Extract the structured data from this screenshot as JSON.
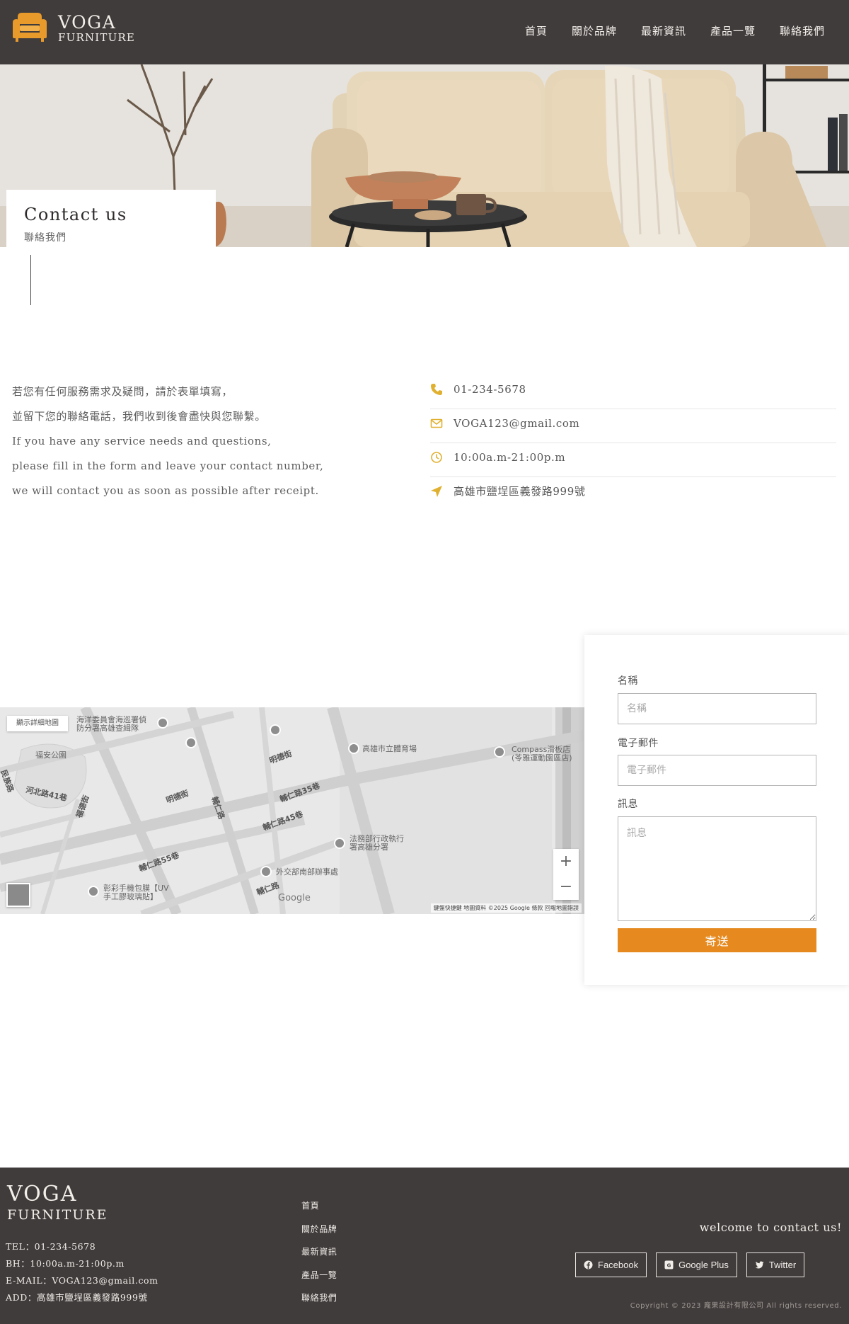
{
  "header": {
    "logo_line1": "VOGA",
    "logo_line2": "FURNITURE",
    "nav": [
      "首頁",
      "關於品牌",
      "最新資訊",
      "產品一覽",
      "聯絡我們"
    ]
  },
  "hero": {
    "title": "Contact us",
    "subtitle": "聯絡我們"
  },
  "intro": {
    "lines": [
      "若您有任何服務需求及疑問，請於表單填寫，",
      "並留下您的聯絡電話，我們收到後會盡快與您聯繫。",
      "If you have any service needs and questions,",
      "please fill in the form and leave your contact number,",
      "we will contact you as soon as possible after receipt."
    ]
  },
  "info": {
    "phone": "01-234-5678",
    "email": "VOGA123@gmail.com",
    "hours": "10:00a.m-21:00p.m",
    "address": "高雄市鹽埕區義發路999號"
  },
  "map": {
    "detail_button": "顯示詳細地圖",
    "labels": {
      "poi1": "海洋委員會海巡署偵\n防分署高雄查緝隊",
      "poi2": "福安公園",
      "poi3": "高雄市立體育場",
      "poi4": "Compass滑板店\n(苓雅運動園區店)",
      "poi5": "法務部行政執行\n署高雄分署",
      "poi6": "外交部南部辦事處",
      "poi7": "彰彩手機包膜【UV\n手工膠玻璃貼】"
    },
    "streets": [
      "明德街",
      "明德街",
      "輔仁路35巷",
      "輔仁路45巷",
      "輔仁路55巷",
      "輔仁路",
      "河北路41巷",
      "福德街",
      "輔仁路",
      "民族路"
    ],
    "brand": "Google",
    "footer": "鍵盤快捷鍵   地圖資料 ©2025 Google   條款   回報地圖錯誤",
    "zoom_in": "+",
    "zoom_out": "−"
  },
  "form": {
    "name_label": "名稱",
    "name_placeholder": "名稱",
    "email_label": "電子郵件",
    "email_placeholder": "電子郵件",
    "message_label": "訊息",
    "message_placeholder": "訊息",
    "submit": "寄送"
  },
  "footer": {
    "logo_line1": "VOGA",
    "logo_line2": "FURNITURE",
    "tel": "TEL：01-234-5678",
    "bh": "BH：10:00a.m-21:00p.m",
    "email": "E-MAIL：VOGA123@gmail.com",
    "add": "ADD：高雄市鹽埕區義發路999號",
    "nav": [
      "首頁",
      "關於品牌",
      "最新資訊",
      "產品一覽",
      "聯絡我們"
    ],
    "welcome": "welcome to contact us!",
    "social": [
      "Facebook",
      "Google Plus",
      "Twitter"
    ],
    "copyright": "Copyright © 2023 龐果設計有限公司 All rights reserved."
  },
  "colors": {
    "header_bg": "#413c3c",
    "accent": "#e68a1f",
    "icon_gold": "#e0b030"
  },
  "icons": [
    "chair-logo-icon",
    "phone-icon",
    "mail-icon",
    "clock-icon",
    "location-arrow-icon",
    "facebook-icon",
    "google-plus-icon",
    "twitter-icon"
  ]
}
